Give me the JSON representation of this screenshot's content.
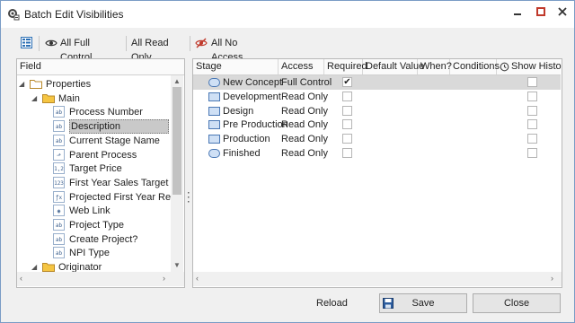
{
  "window": {
    "title": "Batch Edit Visibilities",
    "min_label": "–",
    "max_label": "☐",
    "close_label": "✕"
  },
  "toolbar": {
    "all_full_control": "All Full Control",
    "all_read_only": "All Read Only",
    "all_no_access": "All No Access"
  },
  "field_pane": {
    "header": "Field",
    "items": [
      {
        "label": "Properties",
        "icon": "folder-icon"
      },
      {
        "label": "Main",
        "icon": "folder-icon"
      },
      {
        "label": "Process Number",
        "icon": "ab"
      },
      {
        "label": "Description",
        "icon": "ab"
      },
      {
        "label": "Current Stage Name",
        "icon": "ab"
      },
      {
        "label": "Parent Process",
        "icon": "link"
      },
      {
        "label": "Target Price",
        "icon": "1.2"
      },
      {
        "label": "First Year Sales Target",
        "icon": "123"
      },
      {
        "label": "Projected First Year Rev...",
        "icon": "fx"
      },
      {
        "label": "Web Link",
        "icon": "web"
      },
      {
        "label": "Project Type",
        "icon": "ab"
      },
      {
        "label": "Create Project?",
        "icon": "ab"
      },
      {
        "label": "NPI Type",
        "icon": "ab"
      },
      {
        "label": "Originator",
        "icon": "folder-icon"
      }
    ]
  },
  "grid": {
    "columns": [
      "Stage",
      "Access",
      "Required",
      "Default Value",
      "When?",
      "Conditions",
      "Show History"
    ],
    "rows": [
      {
        "stage": "New Concept",
        "access": "Full Control",
        "required": true,
        "show_history": false
      },
      {
        "stage": "Development",
        "access": "Read Only",
        "required": false,
        "show_history": false
      },
      {
        "stage": "Design",
        "access": "Read Only",
        "required": false,
        "show_history": false
      },
      {
        "stage": "Pre Production",
        "access": "Read Only",
        "required": false,
        "show_history": false
      },
      {
        "stage": "Production",
        "access": "Read Only",
        "required": false,
        "show_history": false
      },
      {
        "stage": "Finished",
        "access": "Read Only",
        "required": false,
        "show_history": false
      }
    ]
  },
  "footer": {
    "reload": "Reload",
    "save": "Save",
    "close": "Close"
  },
  "colors": {
    "accent": "#2b6fb5",
    "selection": "#c9c9c9",
    "row_highlight": "#d9d9d9",
    "no_access": "#c0392b"
  }
}
